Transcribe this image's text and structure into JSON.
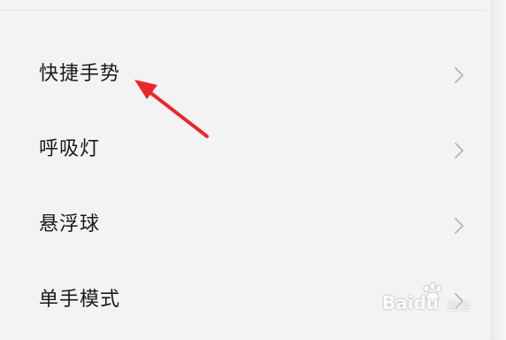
{
  "settings_list": {
    "items": [
      {
        "label": "快捷手势",
        "icon": "chevron-right-icon"
      },
      {
        "label": "呼吸灯",
        "icon": "chevron-right-icon"
      },
      {
        "label": "悬浮球",
        "icon": "chevron-right-icon"
      },
      {
        "label": "单手模式",
        "icon": "chevron-right-icon"
      }
    ]
  },
  "annotation": {
    "arrow_color": "#e8282b",
    "target": "快捷手势"
  },
  "watermark": {
    "text": "Baidu",
    "sub_text": "经验",
    "icon": "paw-icon"
  },
  "colors": {
    "background": "#f3f3f3",
    "text": "#1a1a1a",
    "chevron": "#b5b5b5",
    "divider": "#e3e3e3"
  }
}
